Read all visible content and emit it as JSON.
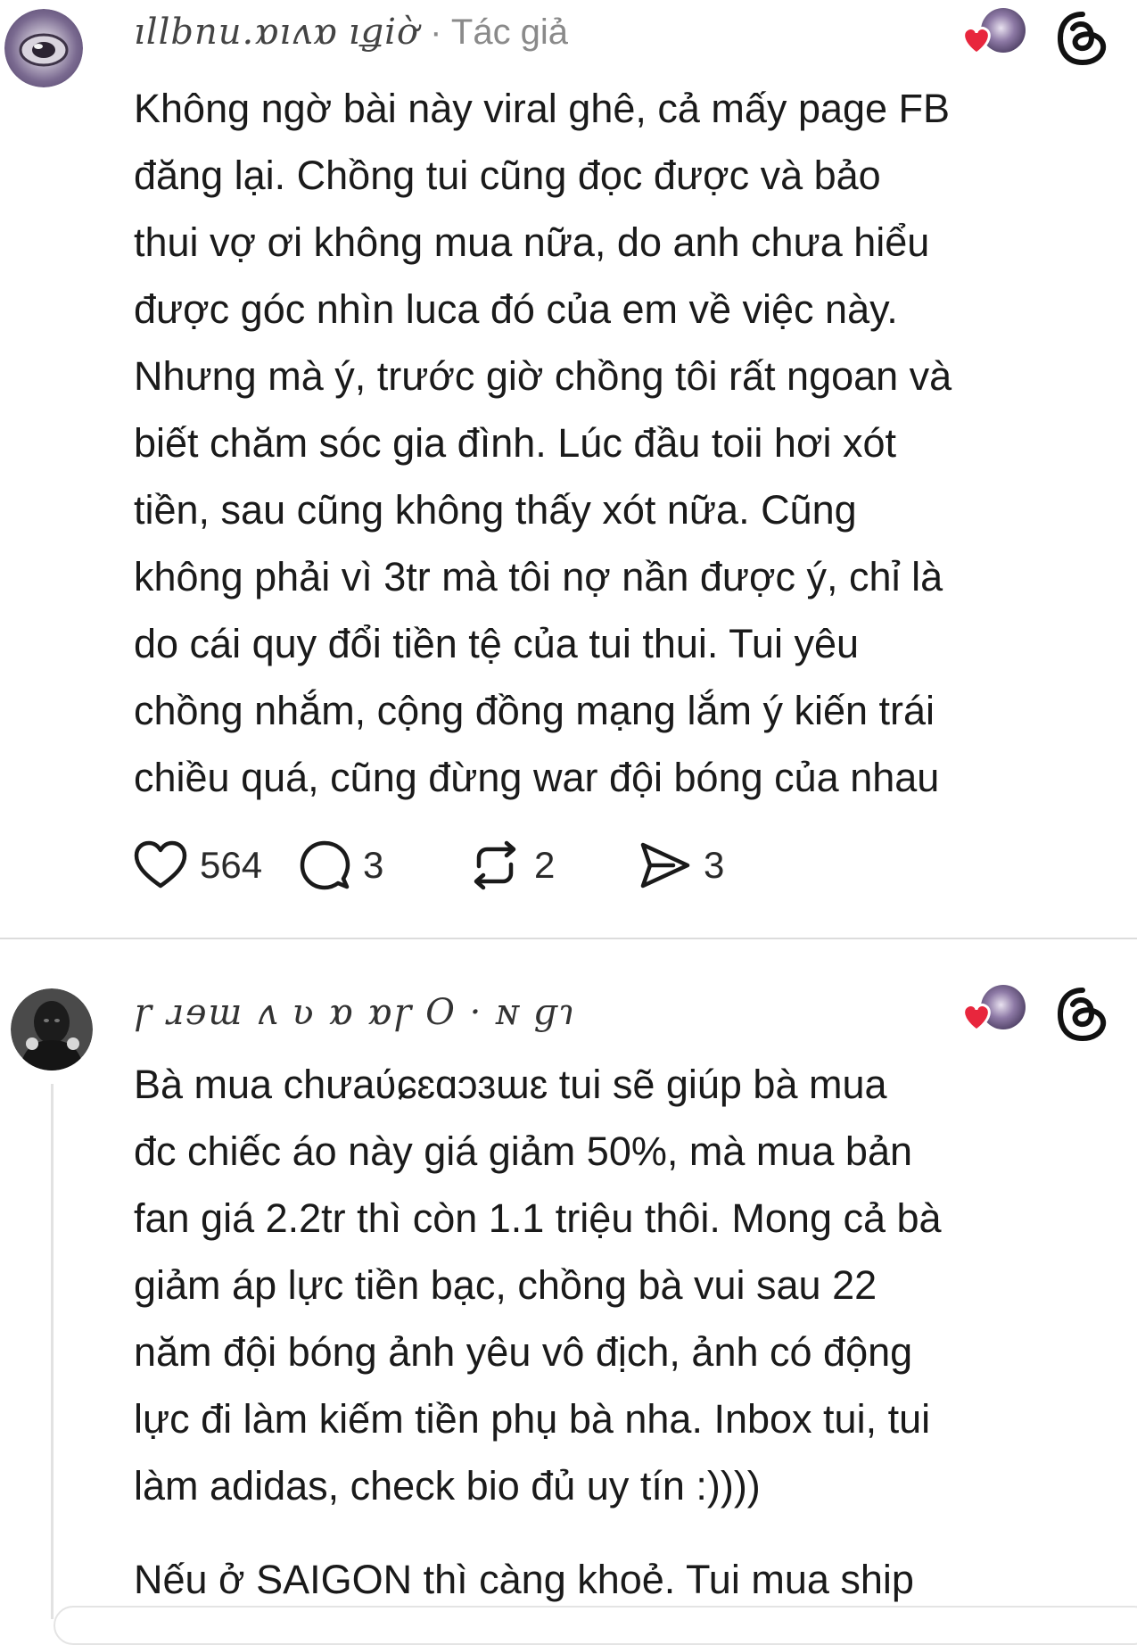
{
  "post1": {
    "author_name": "ıllbnu.ɒıʌɒ",
    "time": "ıǥiờ",
    "author_tag": "· Tác giả",
    "body_lines": [
      "Không ngờ bài này viral ghê, cả mấy page FB",
      "đăng lại. Chồng tui cũng đọc được và bảo",
      "thui vợ ơi không mua nữa, do anh chưa hiểu",
      "được góc nhìn luca đó của em về việc này.",
      "Nhưng mà ý, trước giờ chồng tôi rất ngoan và",
      "biết chăm sóc gia đình. Lúc đầu toii hơi xót",
      "tiền, sau cũng không thấy xót nữa. Cũng",
      "không phải vì 3tr mà tôi nợ nần được ý, chỉ là",
      "do cái quy đổi tiền tệ của tui thui. Tui yêu",
      "chồng nhắm, cộng đồng mạng lắm ý kiến trái",
      "chiều quá, cũng đừng war đội bóng của nhau"
    ],
    "likes": "564",
    "replies": "3",
    "reposts": "2",
    "shares": "3",
    "icons": {
      "like": "heart-outline-icon",
      "reply": "comment-bubble-icon",
      "repost": "repost-arrows-icon",
      "share": "send-arrow-icon",
      "app": "threads-logo-icon",
      "liked_by": "liked-heart-badge-icon"
    }
  },
  "post2": {
    "author_name": "ɼ  ɹɘɯ ʌ  ʋ ɒ   ɒɼ  O  ·  ɴ ɡɿ",
    "body_lines": [
      "Bà mua chưaʋ́ɕɛɑɔɜɯɛ tui sẽ giúp bà mua",
      "đc chiếc áo này giá giảm 50%, mà mua bản",
      "fan giá 2.2tr thì còn 1.1 triệu thôi. Mong cả bà",
      "giảm áp lực tiền bạc, chồng bà vui sau 22",
      "năm đội bóng ảnh yêu vô địch, ảnh có động",
      "lực đi làm kiếm tiền phụ bà nha. Inbox tui, tui",
      "làm adidas, check bio đủ uy tín :))))"
    ],
    "continuation": "Nếu ở SAIGON thì càng khoẻ. Tui mua ship"
  },
  "colors": {
    "text": "#1a1a1a",
    "meta": "#8a8a8a",
    "heart": "#e8263d",
    "divider": "#dcdcdc",
    "avatar_purple": "#6f5c8c"
  }
}
